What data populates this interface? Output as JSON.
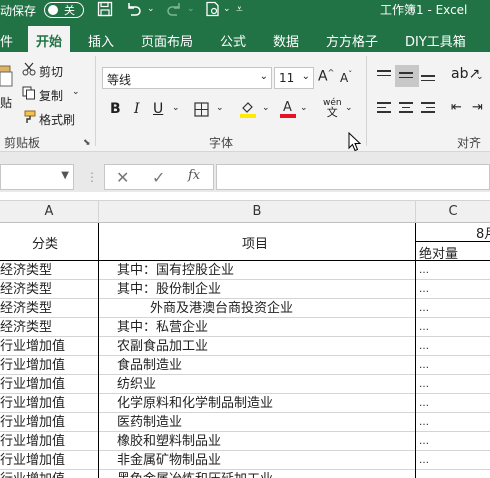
{
  "titlebar": {
    "autosave_label": "动保存",
    "autosave_state": "关",
    "doc_title": "工作簿1  -  Excel"
  },
  "tabs": [
    "件",
    "开始",
    "插入",
    "页面布局",
    "公式",
    "数据",
    "方方格子",
    "DIY工具箱"
  ],
  "ribbon": {
    "clipboard": {
      "cut": "剪切",
      "copy": "复制",
      "format_painter": "格式刷",
      "paste": "贴",
      "label": "剪贴板"
    },
    "font": {
      "name": "等线",
      "size": "11",
      "bold": "B",
      "italic": "I",
      "underline": "U",
      "label": "字体",
      "wen": "wén",
      "wen_char": "文"
    },
    "align": {
      "label": "对齐方"
    }
  },
  "formula_bar": {
    "cancel": "✕",
    "enter": "✓",
    "fx": "fx",
    "value": ""
  },
  "grid": {
    "columns": [
      "A",
      "B",
      "C"
    ],
    "header_row": {
      "a": "分类",
      "b": "项目",
      "c_top": "8月",
      "c_sub": "绝对量"
    },
    "rows": [
      {
        "a": "经济类型",
        "b": "其中：国有控股企业",
        "c": "…"
      },
      {
        "a": "经济类型",
        "b": "其中：股份制企业",
        "c": "…"
      },
      {
        "a": "经济类型",
        "b": "        外商及港澳台商投资企业",
        "c": "…"
      },
      {
        "a": "经济类型",
        "b": "其中：私营企业",
        "c": "…"
      },
      {
        "a": "行业增加值",
        "b": "农副食品加工业",
        "c": "…"
      },
      {
        "a": "行业增加值",
        "b": "食品制造业",
        "c": "…"
      },
      {
        "a": "行业增加值",
        "b": "纺织业",
        "c": "…"
      },
      {
        "a": "行业增加值",
        "b": "化学原料和化学制品制造业",
        "c": "…"
      },
      {
        "a": "行业增加值",
        "b": "医药制造业",
        "c": "…"
      },
      {
        "a": "行业增加值",
        "b": "橡胶和塑料制品业",
        "c": "…"
      },
      {
        "a": "行业增加值",
        "b": "非金属矿物制品业",
        "c": "…"
      },
      {
        "a": "行业增加值",
        "b": "黑色金属冶炼和压延加工业",
        "c": "…"
      }
    ]
  },
  "colors": {
    "excel_green": "#217346",
    "underline_red": "#e81123",
    "highlight_yellow": "#ffeb00"
  }
}
